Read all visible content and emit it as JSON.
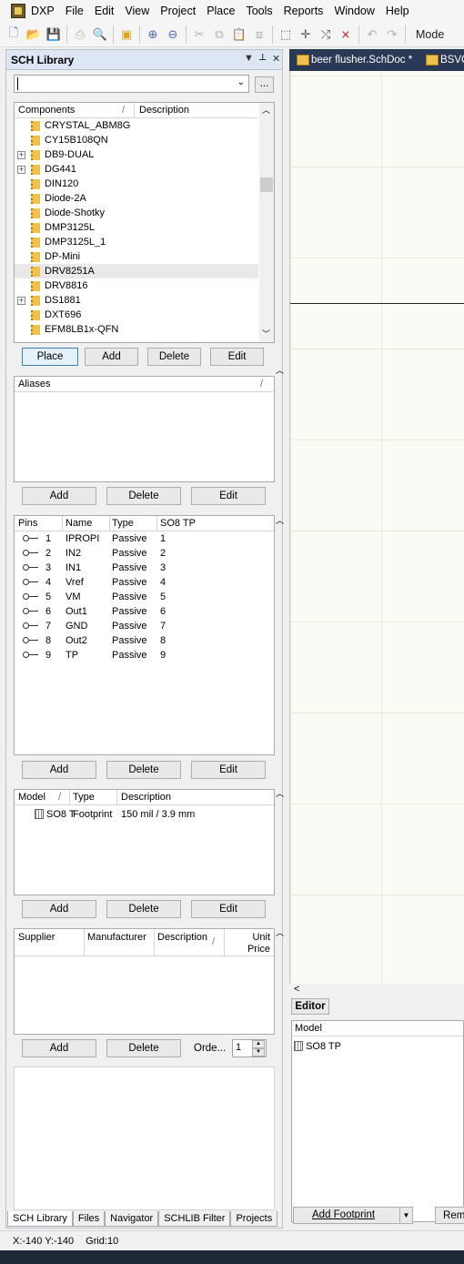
{
  "menu": {
    "items": [
      "DXP",
      "File",
      "Edit",
      "View",
      "Project",
      "Place",
      "Tools",
      "Reports",
      "Window",
      "Help"
    ]
  },
  "toolbar": {
    "mode_label": "Mode",
    "icons": [
      "new-icon",
      "open-icon",
      "save-icon",
      "print-icon",
      "print-preview-icon",
      "open-project-icon",
      "zoom-in-icon",
      "zoom-out-icon",
      "cut-icon",
      "copy-icon",
      "paste-icon",
      "rubber-stamp-icon",
      "select-area-icon",
      "move-icon",
      "deselect-icon",
      "clear-filter-icon",
      "undo-icon",
      "redo-icon"
    ]
  },
  "doc_tabs": [
    "beer flusher.SchDoc *",
    "BSVC"
  ],
  "panel": {
    "title": "SCH Library",
    "header_controls": [
      "▼",
      "📌",
      "✕"
    ],
    "filter_value": "",
    "filter_button": "...",
    "components": {
      "columns": [
        "Components",
        "Description"
      ],
      "rows": [
        {
          "name": "CRYSTAL_ABM8G",
          "expandable": false,
          "selected": false
        },
        {
          "name": "CY15B108QN",
          "expandable": false,
          "selected": false
        },
        {
          "name": "DB9-DUAL",
          "expandable": true,
          "selected": false
        },
        {
          "name": "DG441",
          "expandable": true,
          "selected": false
        },
        {
          "name": "DIN120",
          "expandable": false,
          "selected": false
        },
        {
          "name": "Diode-2A",
          "expandable": false,
          "selected": false
        },
        {
          "name": "Diode-Shotky",
          "expandable": false,
          "selected": false
        },
        {
          "name": "DMP3125L",
          "expandable": false,
          "selected": false
        },
        {
          "name": "DMP3125L_1",
          "expandable": false,
          "selected": false
        },
        {
          "name": "DP-Mini",
          "expandable": false,
          "selected": false
        },
        {
          "name": "DRV8251A",
          "expandable": false,
          "selected": true
        },
        {
          "name": "DRV8816",
          "expandable": false,
          "selected": false
        },
        {
          "name": "DS1881",
          "expandable": true,
          "selected": false
        },
        {
          "name": "DXT696",
          "expandable": false,
          "selected": false
        },
        {
          "name": "EFM8LB1x-QFN",
          "expandable": false,
          "selected": false
        }
      ],
      "buttons": [
        "Place",
        "Add",
        "Delete",
        "Edit"
      ]
    },
    "aliases": {
      "columns": [
        "Aliases"
      ],
      "buttons": [
        "Add",
        "Delete",
        "Edit"
      ]
    },
    "pins": {
      "columns": [
        "Pins",
        "Name",
        "Type",
        "SO8 TP"
      ],
      "rows": [
        {
          "pin": "1",
          "name": "IPROPI",
          "type": "Passive",
          "num": "1"
        },
        {
          "pin": "2",
          "name": "IN2",
          "type": "Passive",
          "num": "2"
        },
        {
          "pin": "3",
          "name": "IN1",
          "type": "Passive",
          "num": "3"
        },
        {
          "pin": "4",
          "name": "Vref",
          "type": "Passive",
          "num": "4"
        },
        {
          "pin": "5",
          "name": "VM",
          "type": "Passive",
          "num": "5"
        },
        {
          "pin": "6",
          "name": "Out1",
          "type": "Passive",
          "num": "6"
        },
        {
          "pin": "7",
          "name": "GND",
          "type": "Passive",
          "num": "7"
        },
        {
          "pin": "8",
          "name": "Out2",
          "type": "Passive",
          "num": "8"
        },
        {
          "pin": "9",
          "name": "TP",
          "type": "Passive",
          "num": "9"
        }
      ],
      "buttons": [
        "Add",
        "Delete",
        "Edit"
      ]
    },
    "models": {
      "columns": [
        "Model",
        "Type",
        "Description"
      ],
      "rows": [
        {
          "model": "SO8 T",
          "type": "Footprint",
          "description": "150 mil / 3.9 mm"
        }
      ],
      "buttons": [
        "Add",
        "Delete",
        "Edit"
      ]
    },
    "suppliers": {
      "columns": [
        "Supplier",
        "Manufacturer",
        "Description",
        "Unit Price"
      ],
      "buttons": [
        "Add",
        "Delete"
      ],
      "order_label": "Orde...",
      "order_value": "1"
    },
    "tabs": [
      "SCH Library",
      "Files",
      "Navigator",
      "SCHLIB Filter",
      "Projects"
    ]
  },
  "editor": {
    "tab_label": "Editor",
    "scroll_left": "<",
    "model_header": "Model",
    "model_item": "SO8 TP",
    "add_footprint_label": "Add Footprint",
    "remove_label": "Rem"
  },
  "status": {
    "coords": "X:-140 Y:-140",
    "grid": "Grid:10"
  }
}
